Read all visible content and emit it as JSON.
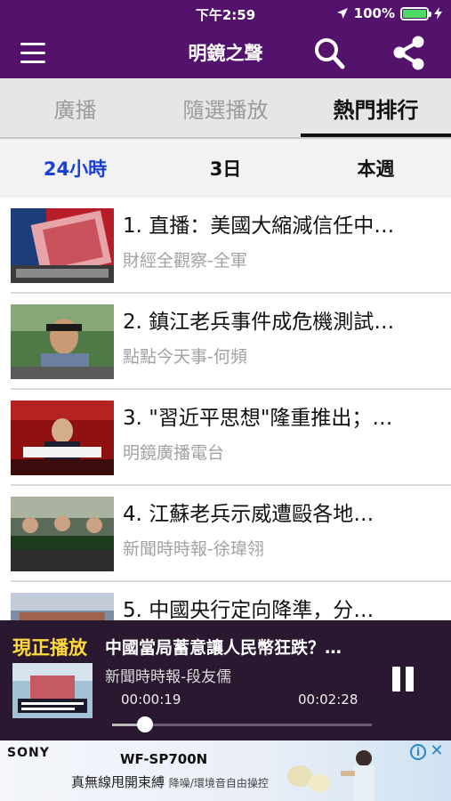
{
  "status_bar": {
    "time": "下午2:59",
    "battery_percent": "100%",
    "battery_level": 1.0
  },
  "header": {
    "title": "明鏡之聲",
    "menu_icon": "hamburger-menu-icon",
    "search_icon": "search-icon",
    "share_icon": "share-icon"
  },
  "tabs": [
    {
      "label": "廣播",
      "active": false
    },
    {
      "label": "隨選播放",
      "active": false
    },
    {
      "label": "熱門排行",
      "active": true
    }
  ],
  "time_filters": [
    {
      "label": "24小時",
      "active": true
    },
    {
      "label": "3日",
      "active": false
    },
    {
      "label": "本週",
      "active": false
    }
  ],
  "items": [
    {
      "title": "1. 直播：美國大縮減信任中…",
      "subtitle": "財經全觀察-全軍"
    },
    {
      "title": "2. 鎮江老兵事件成危機測試…",
      "subtitle": "點點今天事-何頻"
    },
    {
      "title": "3. \"習近平思想\"隆重推出；…",
      "subtitle": "明鏡廣播電台"
    },
    {
      "title": "4. 江蘇老兵示威遭毆各地…",
      "subtitle": "新聞時時報-徐瑋翎"
    },
    {
      "title": "5. 中國央行定向降準，分…",
      "subtitle": ""
    }
  ],
  "player": {
    "label": "現正播放",
    "title": "中國當局蓄意讓人民幣狂跌？…",
    "author": "新聞時時報-段友儒",
    "current_time": "00:00:19",
    "duration": "00:02:28",
    "progress_fraction": 0.128
  },
  "ad": {
    "brand": "SONY",
    "model": "WF-SP700N",
    "tagline": "真無線甩開束縛",
    "tagline_small": "降噪/環境音自由操控",
    "info_label": "i",
    "close_label": "✕"
  },
  "colors": {
    "header": "#53126b",
    "active_filter": "#1a3fd6",
    "player_bg": "#2a1830",
    "player_label": "#ffd93d",
    "battery": "#4cd964"
  }
}
